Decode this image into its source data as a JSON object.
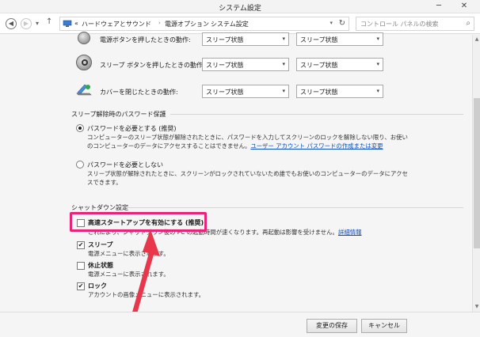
{
  "window": {
    "title": "システム設定",
    "minimize": "─",
    "close": "✕"
  },
  "nav": {
    "back": "◀",
    "forward": "▶",
    "recent": "▾",
    "up": "↑",
    "breadcrumb_lead": "«",
    "breadcrumbs": [
      "ハードウェアとサウンド",
      "電源オプション",
      "システム設定"
    ],
    "separator": "›",
    "address_dropdown": "▾",
    "refresh": "↻",
    "search_placeholder": "コントロール パネルの検索",
    "search_icon": "⌕"
  },
  "power_rows": [
    {
      "icon": "power-button-icon",
      "label": "電源ボタンを押したときの動作:",
      "battery": "スリープ状態",
      "plugged": "スリープ状態"
    },
    {
      "icon": "sleep-button-icon",
      "label": "スリープ ボタンを押したときの動作:",
      "battery": "スリープ状態",
      "plugged": "スリープ状態"
    },
    {
      "icon": "lid-icon",
      "label": "カバーを閉じたときの動作:",
      "battery": "スリープ状態",
      "plugged": "スリープ状態"
    }
  ],
  "password": {
    "title": "スリープ解除時のパスワード保護",
    "require_label": "パスワードを必要とする (推奨)",
    "require_desc_1": "コンピューターのスリープ状態が解除されたときに、パスワードを入力してスクリーンのロックを解除しない限り、お使い",
    "require_desc_2_prefix": "のコンピューターのデータにアクセスすることはできません。",
    "require_desc_link": "ユーザー アカウント パスワードの作成または変更",
    "not_require_label": "パスワードを必要としない",
    "not_require_desc_1": "スリープ状態が解除されたときに、スクリーンがロックされていないため誰でもお使いのコンピューターのデータにアクセ",
    "not_require_desc_2": "スできます。"
  },
  "shutdown": {
    "title": "シャットダウン設定",
    "fast_startup_label": "高速スタートアップを有効にする (推奨)",
    "fast_startup_desc": "これにより、シャットダウン後の PC の起動時間が速くなります。再起動は影響を受けません。",
    "fast_startup_link": "詳細情報",
    "sleep_label": "スリープ",
    "sleep_desc": "電源メニューに表示されます。",
    "hibernate_label": "休止状態",
    "hibernate_desc": "電源メニューに表示されます。",
    "lock_label": "ロック",
    "lock_desc": "アカウントの画像メニューに表示されます。",
    "check_mark": "✔"
  },
  "footer": {
    "save": "変更の保存",
    "cancel": "キャンセル"
  },
  "colors": {
    "highlight": "#e8237a",
    "arrow": "#e8364a",
    "link": "#0a4fbf"
  },
  "state": {
    "password_required": true,
    "fast_startup": false,
    "sleep": true,
    "hibernate": false,
    "lock": true
  }
}
